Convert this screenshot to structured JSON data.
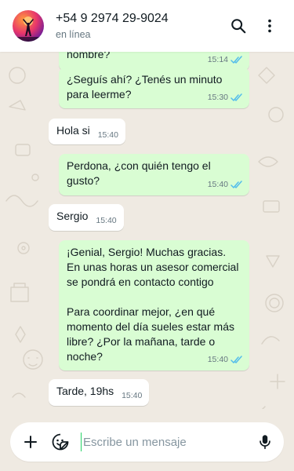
{
  "header": {
    "contact_name": "+54 9 2974 29-9024",
    "status": "en línea",
    "icons": [
      "search-icon",
      "more-vertical-icon"
    ]
  },
  "messages": [
    {
      "dir": "out",
      "text": "nombre?",
      "time": "15:14",
      "read": true
    },
    {
      "dir": "out",
      "text": "¿Seguís ahí? ¿Tenés un minuto para leerme?",
      "time": "15:30",
      "read": true
    },
    {
      "dir": "in",
      "text": "Hola si",
      "time": "15:40"
    },
    {
      "dir": "out",
      "text": "Perdona, ¿con quién tengo el gusto?",
      "time": "15:40",
      "read": true
    },
    {
      "dir": "in",
      "text": "Sergio",
      "time": "15:40"
    },
    {
      "dir": "out",
      "text": "¡Genial, Sergio! Muchas gracias. En unas horas un asesor comercial se pondrá en contacto contigo\n\nPara coordinar mejor, ¿en qué momento del día sueles estar más libre? ¿Por la mañana, tarde o noche?",
      "time": "15:40",
      "read": true
    },
    {
      "dir": "in",
      "text": "Tarde, 19hs",
      "time": "15:40"
    }
  ],
  "composer": {
    "placeholder": "Escribe un mensaje",
    "value": "",
    "icons": [
      "plus-icon",
      "sticker-icon",
      "microphone-icon"
    ]
  },
  "colors": {
    "outgoing_bubble": "#d9fdd3",
    "incoming_bubble": "#ffffff",
    "chat_background": "#efeae2",
    "read_tick": "#53bdeb",
    "meta_text": "#667781"
  }
}
